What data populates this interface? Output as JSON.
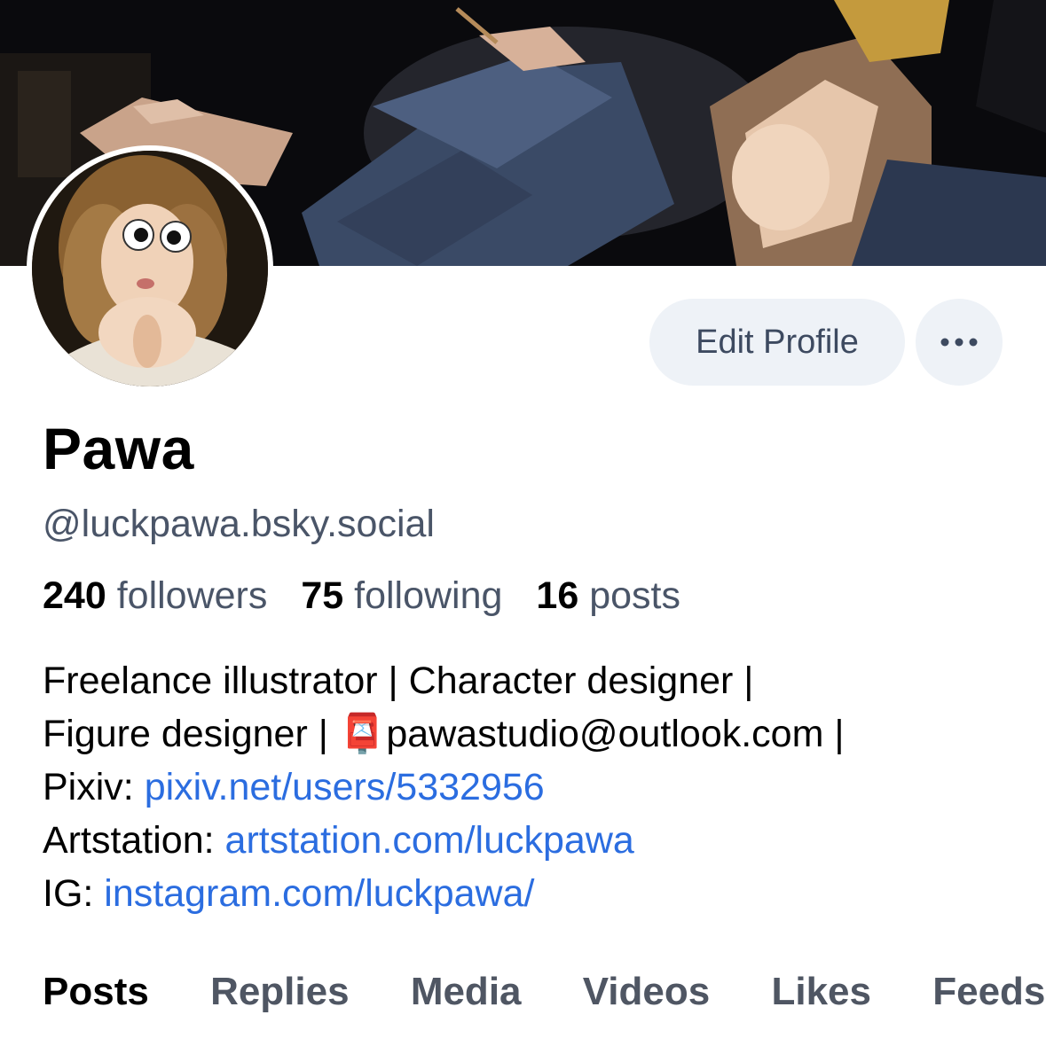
{
  "profile": {
    "display_name": "Pawa",
    "handle": "@luckpawa.bsky.social"
  },
  "actions": {
    "edit_profile_label": "Edit Profile",
    "more_icon": "more-horizontal-icon"
  },
  "stats": {
    "followers_count": "240",
    "followers_label": "followers",
    "following_count": "75",
    "following_label": "following",
    "posts_count": "16",
    "posts_label": "posts"
  },
  "bio": {
    "line1": "Freelance illustrator | Character designer |",
    "line2_prefix": "Figure designer | ",
    "line2_emoji": "📮",
    "line2_email": "pawastudio@outlook.com |",
    "pixiv_label": "Pixiv: ",
    "pixiv_link": "pixiv.net/users/5332956",
    "artstation_label": "Artstation: ",
    "artstation_link": "artstation.com/luckpawa",
    "ig_label": "IG: ",
    "ig_link": "instagram.com/luckpawa/"
  },
  "tabs": [
    {
      "label": "Posts",
      "active": true
    },
    {
      "label": "Replies",
      "active": false
    },
    {
      "label": "Media",
      "active": false
    },
    {
      "label": "Videos",
      "active": false
    },
    {
      "label": "Likes",
      "active": false
    },
    {
      "label": "Feeds",
      "active": false
    }
  ],
  "colors": {
    "link": "#2b6de0",
    "secondary_text": "#4a5568",
    "button_bg": "#eef2f7",
    "button_text": "#3d4a60"
  }
}
